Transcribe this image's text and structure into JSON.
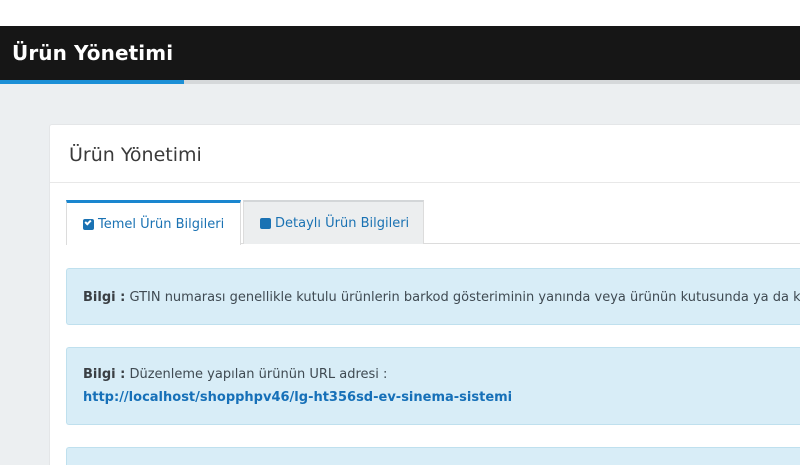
{
  "header": {
    "title": "Ürün Yönetimi"
  },
  "card": {
    "title": "Ürün Yönetimi"
  },
  "tabs": [
    {
      "label": "Temel Ürün Bilgileri",
      "icon": "check-square-icon",
      "active": true
    },
    {
      "label": "Detaylı Ürün Bilgileri",
      "icon": "square-icon",
      "active": false
    }
  ],
  "alerts": [
    {
      "label": "Bilgi :",
      "text": "GTIN numarası genellikle kutulu ürünlerin barkod gösteriminin yanında veya ürünün kutusunda ya da kita"
    },
    {
      "label": "Bilgi :",
      "text": "Düzenleme yapılan ürünün URL adresi :",
      "link": "http://localhost/shopphpv46/lg-ht356sd-ev-sinema-sistemi"
    }
  ],
  "colors": {
    "header_bg": "#161616",
    "accent": "#1c8fd6",
    "alert_bg": "#d8edf7",
    "link": "#1670b8"
  }
}
